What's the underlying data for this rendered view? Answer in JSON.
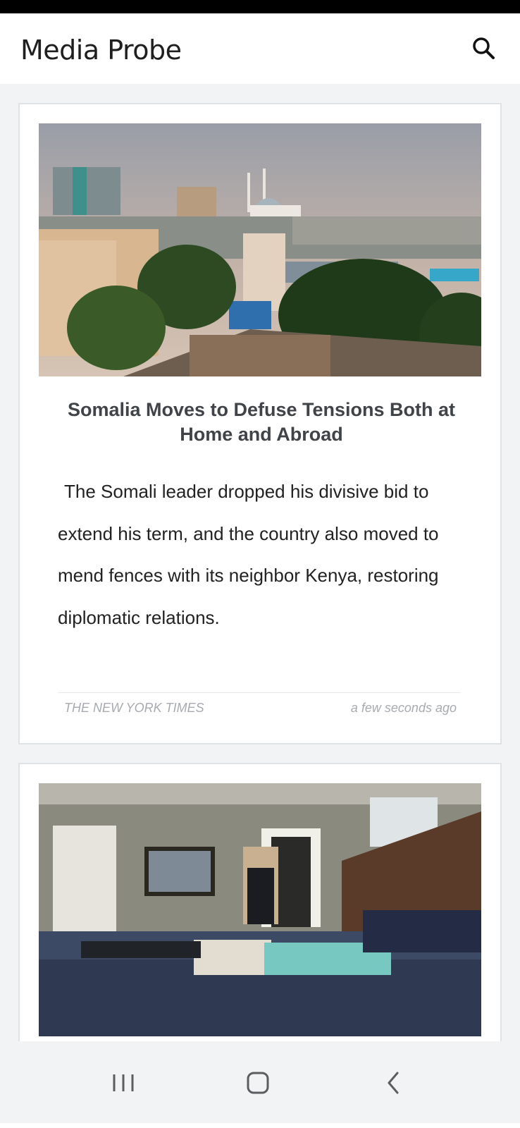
{
  "app": {
    "title": "Media Probe",
    "search_icon": "search-icon"
  },
  "articles": [
    {
      "title": "Somalia Moves to Defuse Tensions Both at Home and Abroad",
      "description": "The Somali leader dropped his divisive bid to extend his term, and the country also moved to mend fences with its neighbor Kenya, restoring diplomatic relations.",
      "source": "THE NEW YORK TIMES",
      "time": "a few seconds ago",
      "image": "city-skyline-photo"
    },
    {
      "image": "bedroom-photo"
    }
  ],
  "navigation": {
    "recent_icon": "recent-apps-icon",
    "home_icon": "home-icon",
    "back_icon": "back-icon"
  },
  "colors": {
    "background": "#f2f3f4",
    "card": "#ffffff",
    "title_text": "#404347",
    "meta_text": "#a7abb0"
  }
}
